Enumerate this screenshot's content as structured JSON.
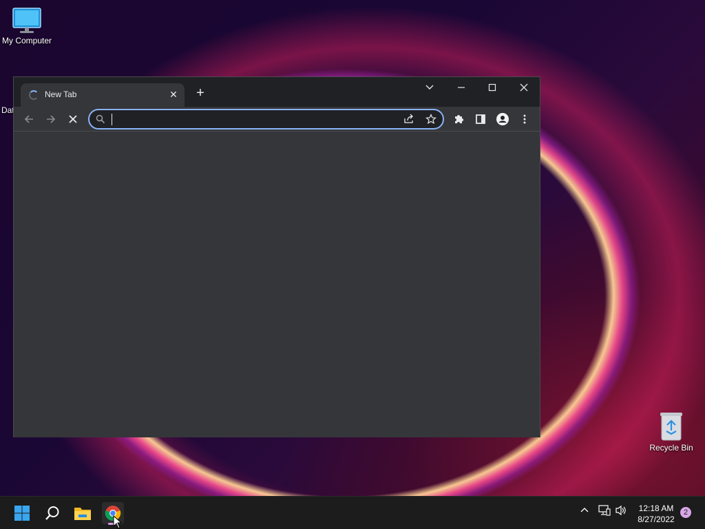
{
  "desktop": {
    "icons": [
      {
        "label": "My Computer"
      },
      {
        "label": "Dat"
      },
      {
        "label": "Recycle Bin"
      }
    ]
  },
  "browser": {
    "tab": {
      "title": "New Tab",
      "close": "✕"
    },
    "new_tab": "+",
    "address": {
      "value": "",
      "placeholder": ""
    },
    "icons": {
      "back": "arrow-left-icon",
      "forward": "arrow-right-icon",
      "stop": "stop-loading-icon",
      "search": "search-icon",
      "share": "share-icon",
      "bookmark": "star-icon",
      "extensions": "puzzle-icon",
      "side_panel": "side-panel-icon",
      "profile": "profile-icon",
      "menu": "kebab-menu-icon"
    },
    "accent": "#8ab4f8"
  },
  "taskbar": {
    "apps": [
      "start",
      "search",
      "file-explorer",
      "chrome"
    ],
    "time": "12:18 AM",
    "date": "8/27/2022",
    "notifications": "2"
  }
}
